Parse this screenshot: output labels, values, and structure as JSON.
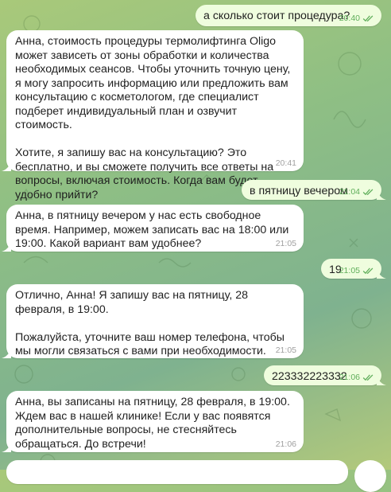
{
  "messages": [
    {
      "id": "m1",
      "dir": "out",
      "text": "а сколько стоит процедура?",
      "time": "20:40",
      "read": true
    },
    {
      "id": "m2",
      "dir": "in",
      "text": "Анна, стоимость процедуры термолифтинга Oligo может зависеть от зоны обработки и количества необходимых сеансов. Чтобы уточнить точную цену, я могу запросить информацию или предложить вам консультацию с косметологом, где специалист подберет индивидуальный план и озвучит стоимость.\n\nХотите, я запишу вас на консультацию? Это бесплатно, и вы сможете получить все ответы на вопросы, включая стоимость. Когда вам будет удобно прийти?",
      "time": "20:41"
    },
    {
      "id": "m3",
      "dir": "out",
      "text": "в пятницу вечером",
      "time": "21:04",
      "read": true
    },
    {
      "id": "m4",
      "dir": "in",
      "text": "Анна, в пятницу вечером у нас есть свободное время. Например, можем записать вас на 18:00 или 19:00. Какой вариант вам удобнее?",
      "time": "21:05"
    },
    {
      "id": "m5",
      "dir": "out",
      "text": "19",
      "time": "21:05",
      "read": true
    },
    {
      "id": "m6",
      "dir": "in",
      "text": "Отлично, Анна! Я запишу вас на пятницу, 28 февраля, в 19:00.\n\nПожалуйста, уточните ваш номер телефона, чтобы мы могли связаться с вами при необходимости.",
      "time": "21:05"
    },
    {
      "id": "m7",
      "dir": "out",
      "text": "223332223332",
      "time": "21:06",
      "read": true
    },
    {
      "id": "m8",
      "dir": "in",
      "text": "Анна, вы записаны на пятницу, 28 февраля, в 19:00. Ждем вас в нашей клинике! Если у вас появятся дополнительные вопросы, не стесняйтесь обращаться. До встречи!",
      "time": "21:06"
    }
  ],
  "colors": {
    "incoming_bubble": "#ffffff",
    "outgoing_bubble": "#effdde",
    "outgoing_meta": "#5fae5a",
    "incoming_meta": "#a0a0a0"
  },
  "icons": {
    "read_receipt": "double-check-icon"
  }
}
